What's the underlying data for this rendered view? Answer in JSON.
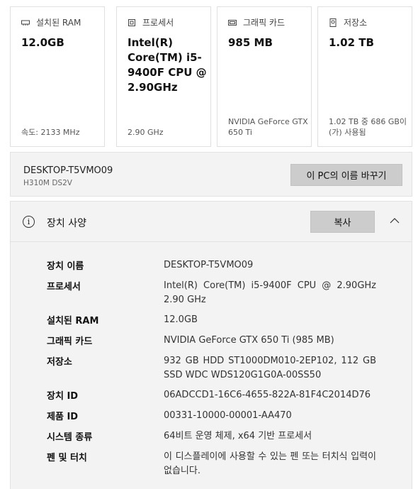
{
  "cards": [
    {
      "icon": "ram-icon",
      "label": "설치된 RAM",
      "value": "12.0GB",
      "footer": "속도: 2133 MHz"
    },
    {
      "icon": "processor-icon",
      "label": "프로세서",
      "value": "Intel(R) Core(TM) i5-9400F CPU @ 2.90GHz",
      "footer": "2.90 GHz"
    },
    {
      "icon": "graphics-card-icon",
      "label": "그래픽 카드",
      "value": "985 MB",
      "footer": "NVIDIA GeForce GTX 650 Ti"
    },
    {
      "icon": "storage-icon",
      "label": "저장소",
      "value": "1.02 TB",
      "footer": "1.02 TB 중 686 GB이(가) 사용됨"
    }
  ],
  "pc": {
    "name": "DESKTOP-T5VMO09",
    "model": "H310M DS2V",
    "rename_button": "이 PC의 이름 바꾸기"
  },
  "device_specs": {
    "title": "장치 사양",
    "copy_button": "복사",
    "rows": [
      {
        "key": "장치 이름",
        "value": "DESKTOP-T5VMO09"
      },
      {
        "key": "프로세서",
        "value": "Intel(R) Core(TM) i5-9400F CPU @ 2.90GHz 2.90 GHz"
      },
      {
        "key": "설치된 RAM",
        "value": "12.0GB"
      },
      {
        "key": "그래픽 카드",
        "value": "NVIDIA GeForce GTX 650 Ti (985 MB)"
      },
      {
        "key": "저장소",
        "value": "932 GB HDD ST1000DM010-2EP102, 112 GB SSD WDC WDS120G1G0A-00SS50"
      },
      {
        "key": "장치 ID",
        "value": "06ADCCD1-16C6-4655-822A-81F4C2014D76"
      },
      {
        "key": "제품 ID",
        "value": "00331-10000-00001-AA470"
      },
      {
        "key": "시스템 종류",
        "value": "64비트 운영 체제, x64 기반 프로세서"
      },
      {
        "key": "펜 및 터치",
        "value": "이 디스플레이에 사용할 수 있는 펜 또는 터치식 입력이 없습니다."
      }
    ]
  }
}
